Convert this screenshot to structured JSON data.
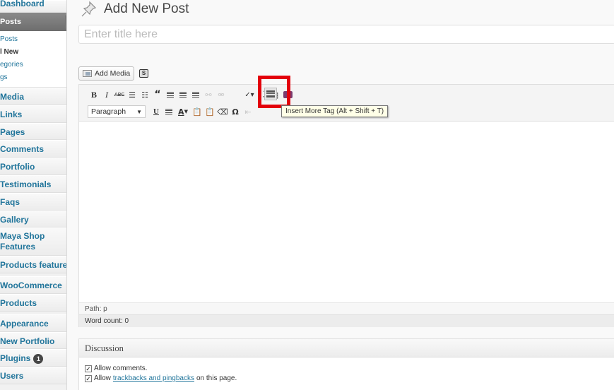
{
  "sidebar": {
    "dashboard": "Dashboard",
    "posts_head": "Posts",
    "posts_sub": [
      "Posts",
      "l New",
      "egories",
      "gs"
    ],
    "items": [
      {
        "label": "Media"
      },
      {
        "label": "Links"
      },
      {
        "label": "Pages"
      },
      {
        "label": "Comments"
      },
      {
        "label": "Portfolio"
      },
      {
        "label": "Testimonials"
      },
      {
        "label": "Faqs"
      },
      {
        "label": "Gallery"
      },
      {
        "label": "Maya Shop Features"
      },
      {
        "label": "Products features"
      },
      {
        "label": "WooCommerce"
      },
      {
        "label": "Products"
      },
      {
        "label": "Appearance"
      },
      {
        "label": "New Portfolio"
      },
      {
        "label": "Plugins",
        "badge": "1"
      },
      {
        "label": "Users"
      }
    ]
  },
  "page": {
    "title": "Add New Post"
  },
  "title_field": {
    "placeholder": "Enter title here",
    "value": ""
  },
  "media": {
    "add_media": "Add Media",
    "s_button": "S"
  },
  "editor": {
    "format_select": "Paragraph",
    "tooltip": "Insert More Tag (Alt + Shift + T)",
    "path": "Path: p",
    "word_count": "Word count: 0"
  },
  "discussion": {
    "title": "Discussion",
    "allow_comments": "Allow comments.",
    "allow_prefix": "Allow",
    "trackbacks_link": "trackbacks and pingbacks",
    "allow_suffix": "on this page."
  },
  "colors": {
    "link": "#21759b",
    "highlight": "#e3000b"
  }
}
